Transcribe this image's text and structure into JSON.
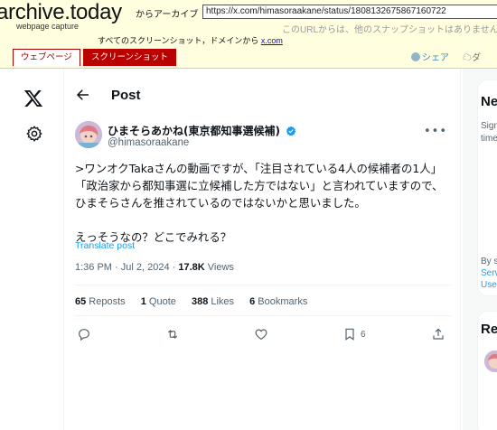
{
  "archive": {
    "logo": "archive.today",
    "subtitle": "webpage capture",
    "from_label": "からアーカイブ",
    "url": "https://x.com/himasoraakane/status/1808132675867160722",
    "note": "このURLからは、他のスナップショットはありませんで",
    "all_snapshots_prefix": "すべてのスクリーンショット，ドメインから",
    "all_snapshots_domain": "x.com",
    "tab_webpage": "ウェブページ",
    "tab_screenshot": "スクリーンショット",
    "share": "シェア",
    "download": "ダ"
  },
  "header": {
    "title": "Post"
  },
  "post": {
    "display_name": "ひまそらあかね(東京都知事選候補)",
    "handle": "@himasoraakane",
    "lines": [
      ">ワンオクTakaさんの動画ですが、「注目されている4人の候補者の1人」",
      "「政治家から都知事選に立候補した方ではない」と言われていますので、",
      "ひまそらさんを推されているのではないかと思いました。",
      "",
      "えっそうなの？どこでみれる？"
    ],
    "translate": "Translate post",
    "time": "1:36 PM · Jul 2, 2024 · ",
    "views_count": "17.8K",
    "views_label": " Views",
    "stats": {
      "reposts_count": "65",
      "reposts_label": " Reposts",
      "quotes_count": "1",
      "quotes_label": " Quote",
      "likes_count": "388",
      "likes_label": " Likes",
      "bookmarks_count": "6",
      "bookmarks_label": " Bookmarks"
    },
    "bookmark_action_count": "6"
  },
  "right_rail": {
    "card1_title": "Ne",
    "card1_line1": "Sign",
    "card1_line2": "time",
    "card1_line3": "By s",
    "card1_link1": "Serv",
    "card1_link2": "Use",
    "card2_title": "Re"
  },
  "colors": {
    "accent": "#1d9bf0",
    "archive_bg": "#ffffe0",
    "archive_red": "#b00000"
  }
}
